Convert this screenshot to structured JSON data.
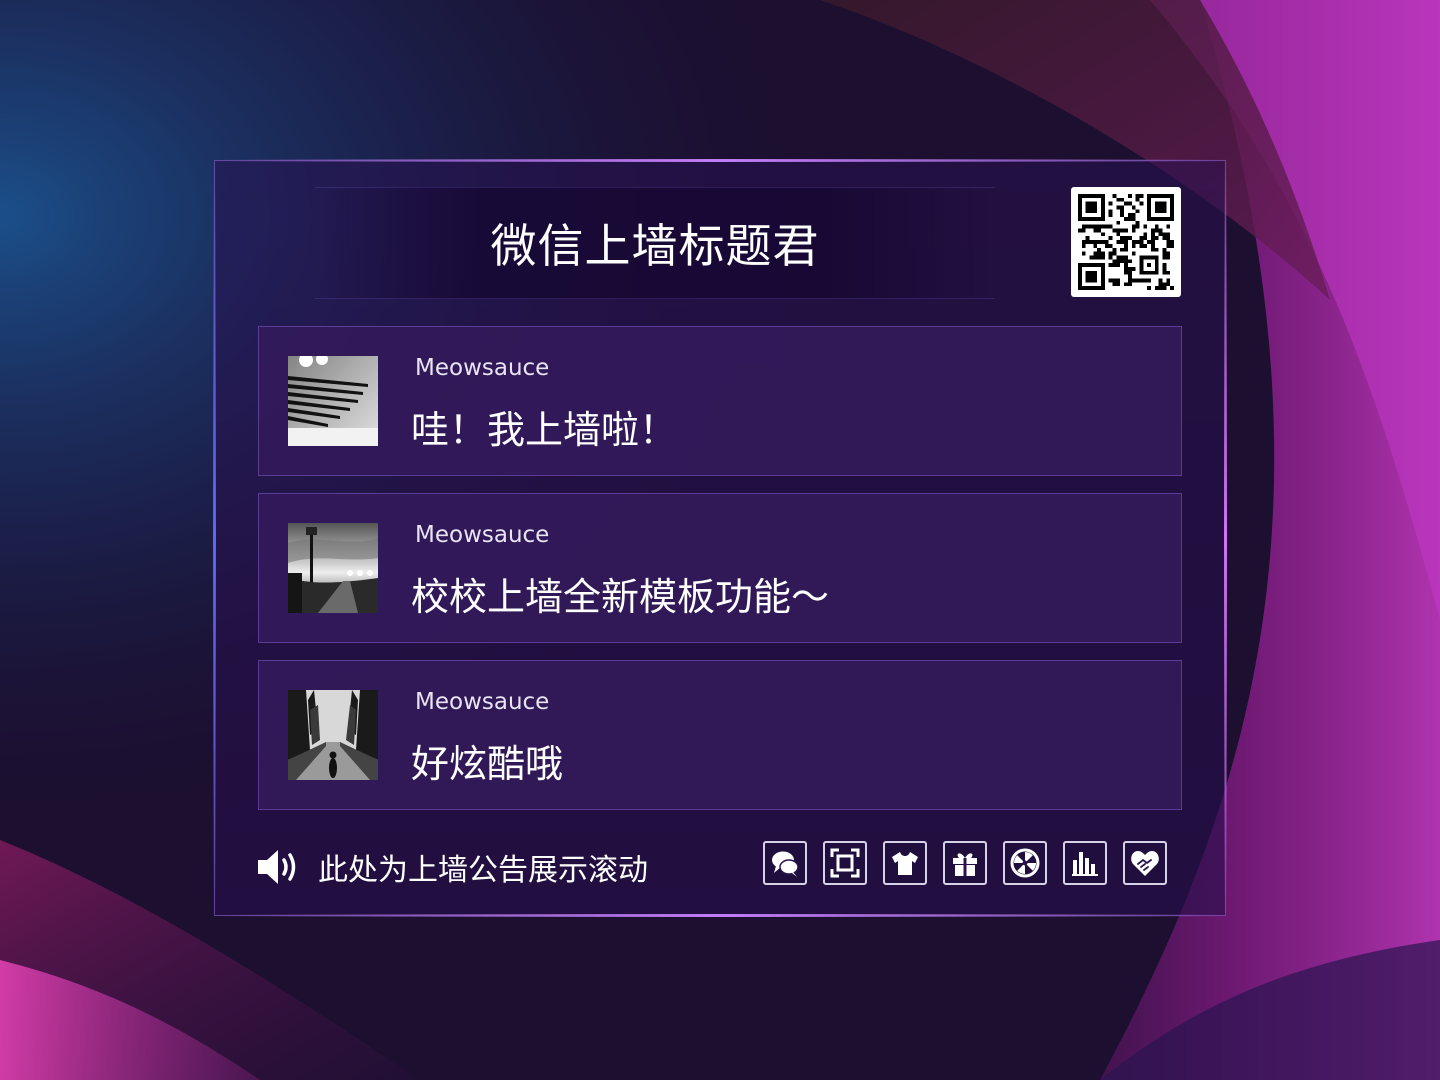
{
  "wall": {
    "title": "微信上墙标题君"
  },
  "messages": [
    {
      "name": "Meowsauce",
      "text": "哇！我上墙啦！",
      "avatar": "piano-keys-photo"
    },
    {
      "name": "Meowsauce",
      "text": "校校上墙全新模板功能～",
      "avatar": "street-lamp-photo"
    },
    {
      "name": "Meowsauce",
      "text": "好炫酷哦",
      "avatar": "forest-road-photo"
    }
  ],
  "notice": {
    "icon": "speaker-icon",
    "text": "此处为上墙公告展示滚动"
  },
  "toolbar": {
    "buttons": [
      {
        "icon": "chat-bubbles-icon"
      },
      {
        "icon": "fullscreen-icon"
      },
      {
        "icon": "tshirt-icon"
      },
      {
        "icon": "gift-icon"
      },
      {
        "icon": "lottery-wheel-icon"
      },
      {
        "icon": "bar-chart-icon"
      },
      {
        "icon": "handshake-heart-icon"
      }
    ]
  },
  "colors": {
    "background": "#1a0d2e",
    "accent_magenta": "#e040d0",
    "accent_blue": "#3050c0",
    "panel_border": "#9a6edc",
    "message_bg": "#341a5c"
  }
}
